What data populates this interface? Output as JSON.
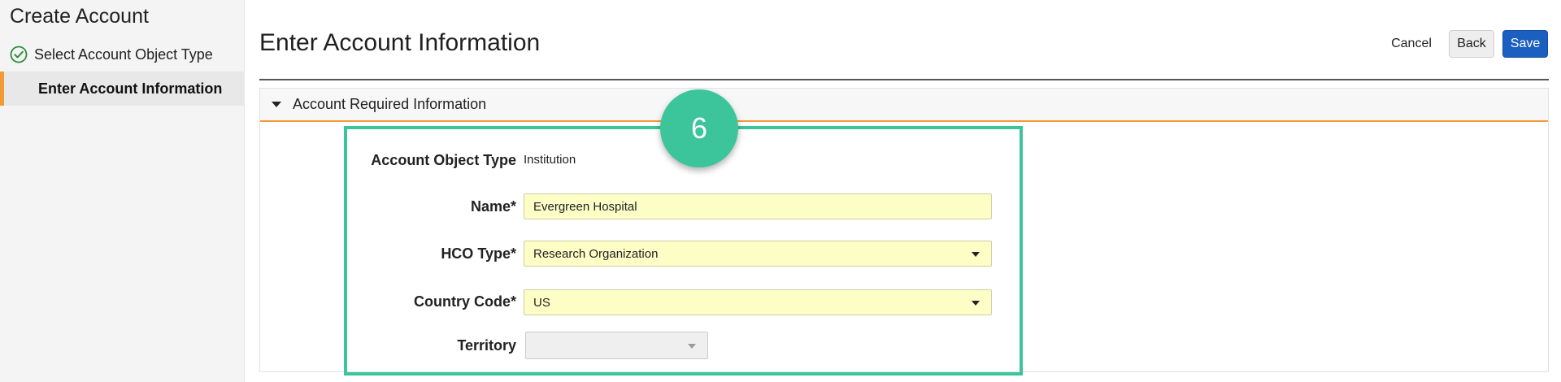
{
  "sidebar": {
    "title": "Create Account",
    "steps": [
      {
        "label": "Select Account Object Type",
        "status": "complete"
      },
      {
        "label": "Enter Account Information",
        "status": "active"
      }
    ]
  },
  "header": {
    "title": "Enter Account Information",
    "buttons": {
      "cancel": "Cancel",
      "back": "Back",
      "save": "Save"
    }
  },
  "section": {
    "title": "Account Required Information",
    "expanded": true
  },
  "badge": {
    "number": "6",
    "color": "#3cc59a"
  },
  "form": {
    "account_object_type": {
      "label": "Account Object Type",
      "value": "Institution"
    },
    "name": {
      "label": "Name*",
      "value": "Evergreen Hospital"
    },
    "hco_type": {
      "label": "HCO Type*",
      "value": "Research Organization"
    },
    "country_code": {
      "label": "Country Code*",
      "value": "US"
    },
    "territory": {
      "label": "Territory",
      "value": "",
      "disabled": true
    }
  },
  "colors": {
    "accent_orange": "#f39a36",
    "primary_button": "#1b5fc1",
    "required_field_bg": "#fdfdc6",
    "success_check": "#2e8b3a",
    "highlight": "#3cc59a"
  },
  "icons": {
    "completed_step": "check-circle-icon",
    "section_toggle": "caret-down-icon",
    "dropdown": "caret-down-icon"
  }
}
